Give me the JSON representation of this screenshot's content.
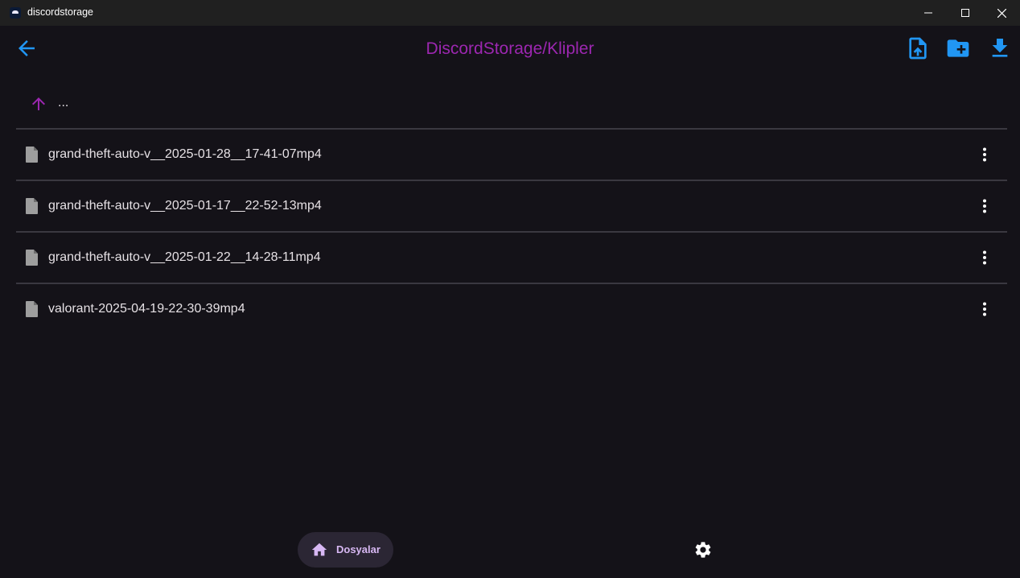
{
  "window": {
    "title": "discordstorage",
    "app_icon": "discordstorage-logo",
    "controls": [
      "minimize-icon",
      "maximize-icon",
      "close-icon"
    ]
  },
  "app_bar": {
    "title": "DiscordStorage/Klipler",
    "back_icon": "arrow-back-icon",
    "actions": [
      "upload-file-icon",
      "create-folder-icon",
      "download-icon"
    ]
  },
  "parent_dir": {
    "icon": "arrow-up-icon",
    "label": "..."
  },
  "files": [
    {
      "name": "grand-theft-auto-v__2025-01-28__17-41-07mp4",
      "icon": "file-icon",
      "menu_icon": "more-vert-icon"
    },
    {
      "name": "grand-theft-auto-v__2025-01-17__22-52-13mp4",
      "icon": "file-icon",
      "menu_icon": "more-vert-icon"
    },
    {
      "name": "grand-theft-auto-v__2025-01-22__14-28-11mp4",
      "icon": "file-icon",
      "menu_icon": "more-vert-icon"
    },
    {
      "name": "valorant-2025-04-19-22-30-39mp4",
      "icon": "file-icon",
      "menu_icon": "more-vert-icon"
    }
  ],
  "bottom_nav": {
    "items": [
      {
        "label": "Dosyalar",
        "icon": "home-icon",
        "selected": true
      },
      {
        "label": "",
        "icon": "settings-icon",
        "selected": false
      }
    ]
  },
  "colors": {
    "background": "#141218",
    "title_purple": "#9c27b0",
    "action_blue": "#2196f3",
    "nav_indicator": "#2b2634",
    "nav_label": "#d7b8f3"
  }
}
